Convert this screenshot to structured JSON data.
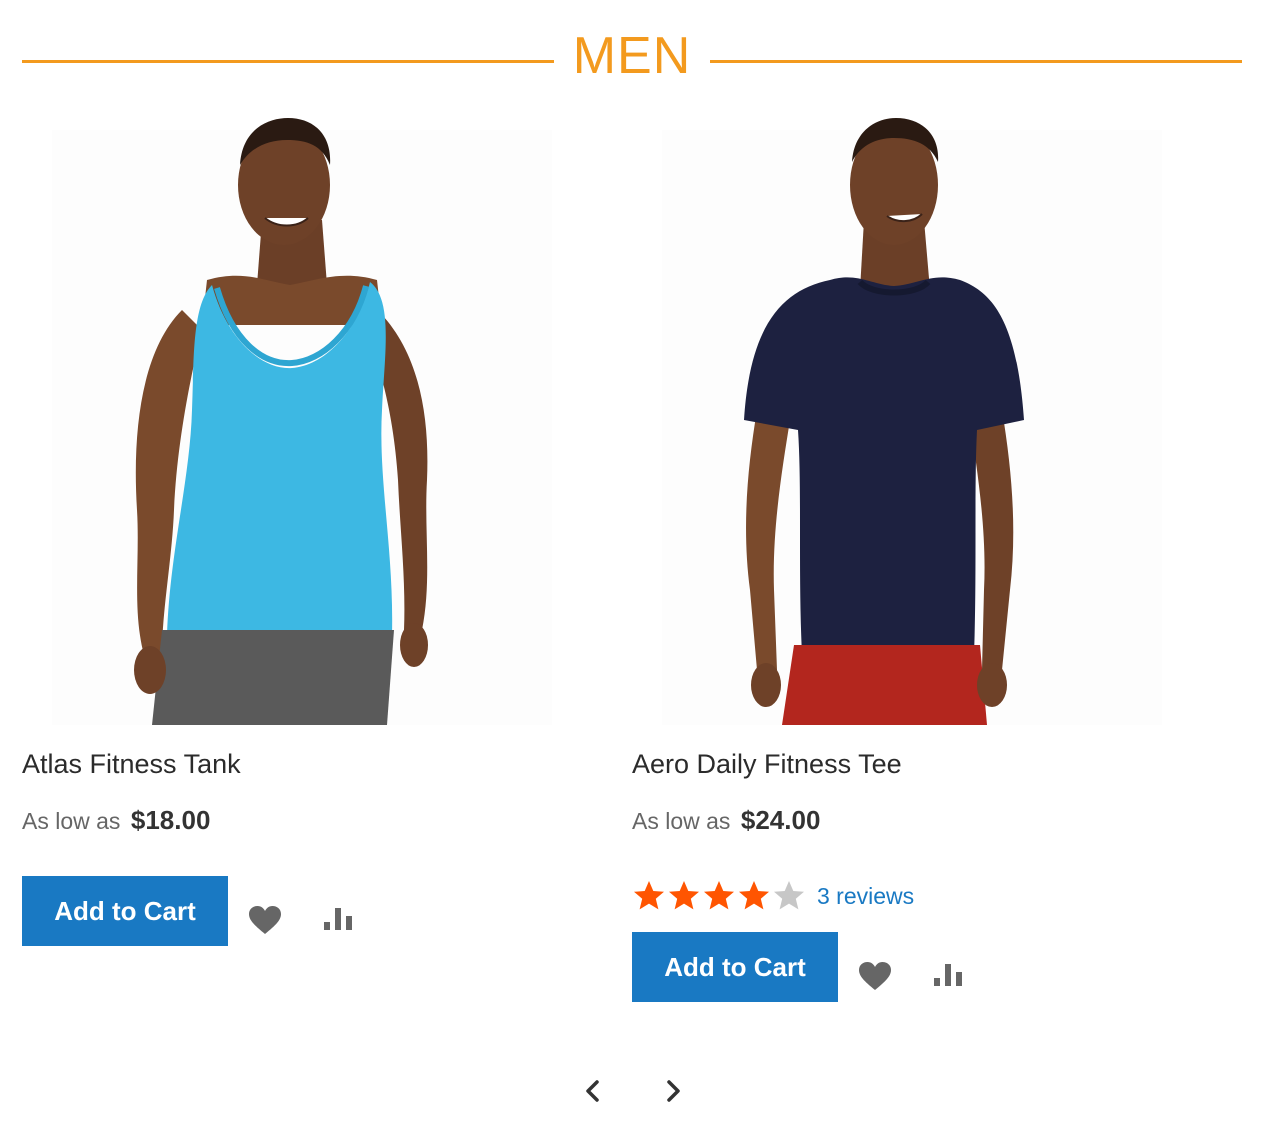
{
  "section": {
    "title": "MEN",
    "accent_color": "#f39a1e"
  },
  "products": [
    {
      "name": "Atlas Fitness Tank",
      "price_prefix": "As low as",
      "price": "$18.00",
      "add_to_cart_label": "Add to Cart",
      "rating": null,
      "reviews_text": null,
      "image": "man-in-light-blue-tank-top",
      "wishlist_icon": "heart-icon",
      "compare_icon": "bar-chart-icon"
    },
    {
      "name": "Aero Daily Fitness Tee",
      "price_prefix": "As low as",
      "price": "$24.00",
      "add_to_cart_label": "Add to Cart",
      "rating": {
        "value": 4,
        "max": 5
      },
      "reviews_text": "3 reviews",
      "image": "man-in-navy-t-shirt-and-red-shorts",
      "wishlist_icon": "heart-icon",
      "compare_icon": "bar-chart-icon"
    }
  ],
  "colors": {
    "button_bg": "#1979c3",
    "button_text": "#ffffff",
    "link": "#1979c3",
    "star_filled": "#ff5501",
    "star_empty": "#c7c7c7",
    "icon": "#666666"
  },
  "carousel": {
    "prev_icon": "chevron-left-icon",
    "next_icon": "chevron-right-icon"
  }
}
